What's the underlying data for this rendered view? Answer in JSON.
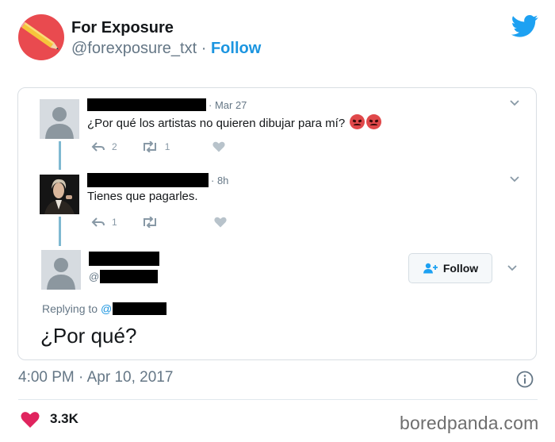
{
  "tweet": {
    "display_name": "For Exposure",
    "handle": "@forexposure_txt",
    "separator": "·",
    "follow_label": "Follow",
    "timestamp": "4:00 PM · Apr 10, 2017",
    "like_count": "3.3K"
  },
  "embedded": {
    "reply1": {
      "date": "· Mar 27",
      "text": "¿Por qué los artistas no quieren dibujar para mí?",
      "reply_count": "2",
      "retweet_count": "1"
    },
    "reply2": {
      "date": "· 8h",
      "text": "Tienes que pagarles.",
      "reply_count": "1"
    },
    "reply3": {
      "handle_prefix": "@",
      "follow_label": "Follow",
      "replying_to_label": "Replying to",
      "replying_to_prefix": "@",
      "text": "¿Por qué?"
    }
  },
  "watermark": "boredpanda.com",
  "colors": {
    "twitter_blue": "#1da1f2",
    "link_blue": "#1b95e0",
    "heart_pink": "#e0245e",
    "avatar_red": "#e94a4f",
    "thread_line": "#7fb9d1"
  },
  "icons": [
    "pencil-icon",
    "twitter-bird-icon",
    "reply-icon",
    "retweet-icon",
    "like-icon",
    "chevron-down-icon",
    "follow-person-icon",
    "info-icon",
    "heart-icon",
    "angry-face-emoji"
  ]
}
